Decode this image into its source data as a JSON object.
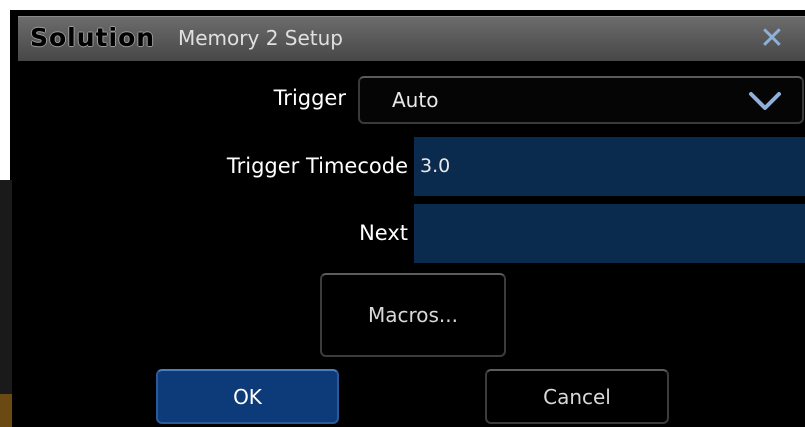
{
  "window": {
    "logo_text": "Solution",
    "title": "Memory 2 Setup",
    "close_glyph": "✕"
  },
  "trigger": {
    "label": "Trigger",
    "value": "Auto",
    "dropdown_icon": "chevron-down-icon"
  },
  "trigger_timecode": {
    "label": "Trigger Timecode",
    "value": "3.0"
  },
  "next": {
    "label": "Next",
    "value": ""
  },
  "buttons": {
    "macros": "Macros...",
    "ok": "OK",
    "cancel": "Cancel"
  },
  "colors": {
    "background": "#000000",
    "title_bar": "#5a5a5a",
    "field_fill": "#0a2a4e",
    "ok_button": "#0d3b7a",
    "close_icon": "#8fb0d8"
  }
}
